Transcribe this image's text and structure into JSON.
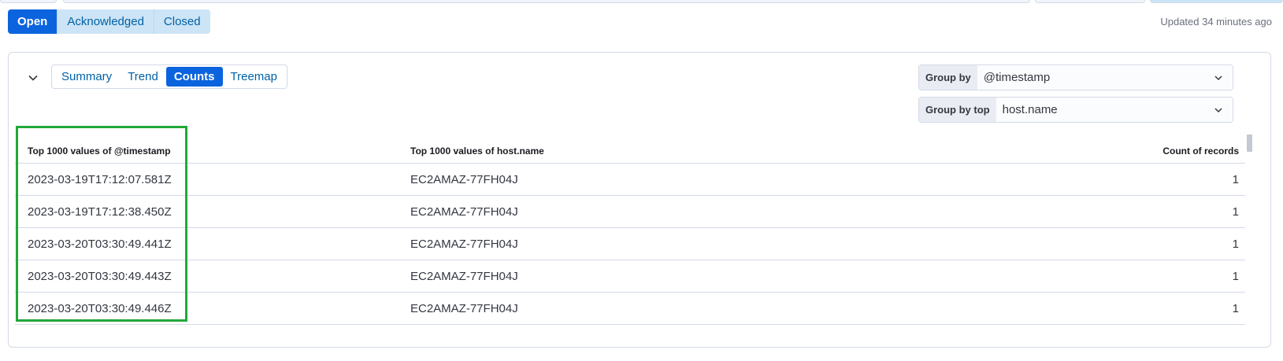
{
  "status_filter": {
    "buttons": [
      {
        "label": "Open",
        "active": true
      },
      {
        "label": "Acknowledged",
        "active": false
      },
      {
        "label": "Closed",
        "active": false
      }
    ]
  },
  "updated_text": "Updated 34 minutes ago",
  "view_tabs": [
    {
      "label": "Summary",
      "active": false
    },
    {
      "label": "Trend",
      "active": false
    },
    {
      "label": "Counts",
      "active": true
    },
    {
      "label": "Treemap",
      "active": false
    }
  ],
  "group_by": {
    "label": "Group by",
    "value": "@timestamp"
  },
  "group_by_top": {
    "label": "Group by top",
    "value": "host.name"
  },
  "table": {
    "headers": [
      "Top 1000 values of @timestamp",
      "Top 1000 values of host.name",
      "Count of records"
    ],
    "rows": [
      [
        "2023-03-19T17:12:07.581Z",
        "EC2AMAZ-77FH04J",
        "1"
      ],
      [
        "2023-03-19T17:12:38.450Z",
        "EC2AMAZ-77FH04J",
        "1"
      ],
      [
        "2023-03-20T03:30:49.441Z",
        "EC2AMAZ-77FH04J",
        "1"
      ],
      [
        "2023-03-20T03:30:49.443Z",
        "EC2AMAZ-77FH04J",
        "1"
      ],
      [
        "2023-03-20T03:30:49.446Z",
        "EC2AMAZ-77FH04J",
        "1"
      ]
    ]
  },
  "colors": {
    "accent": "#0b64dd",
    "highlight": "#22a83a"
  },
  "icons": {
    "collapse": "chevron-down-icon",
    "dropdown": "chevron-down-icon"
  }
}
